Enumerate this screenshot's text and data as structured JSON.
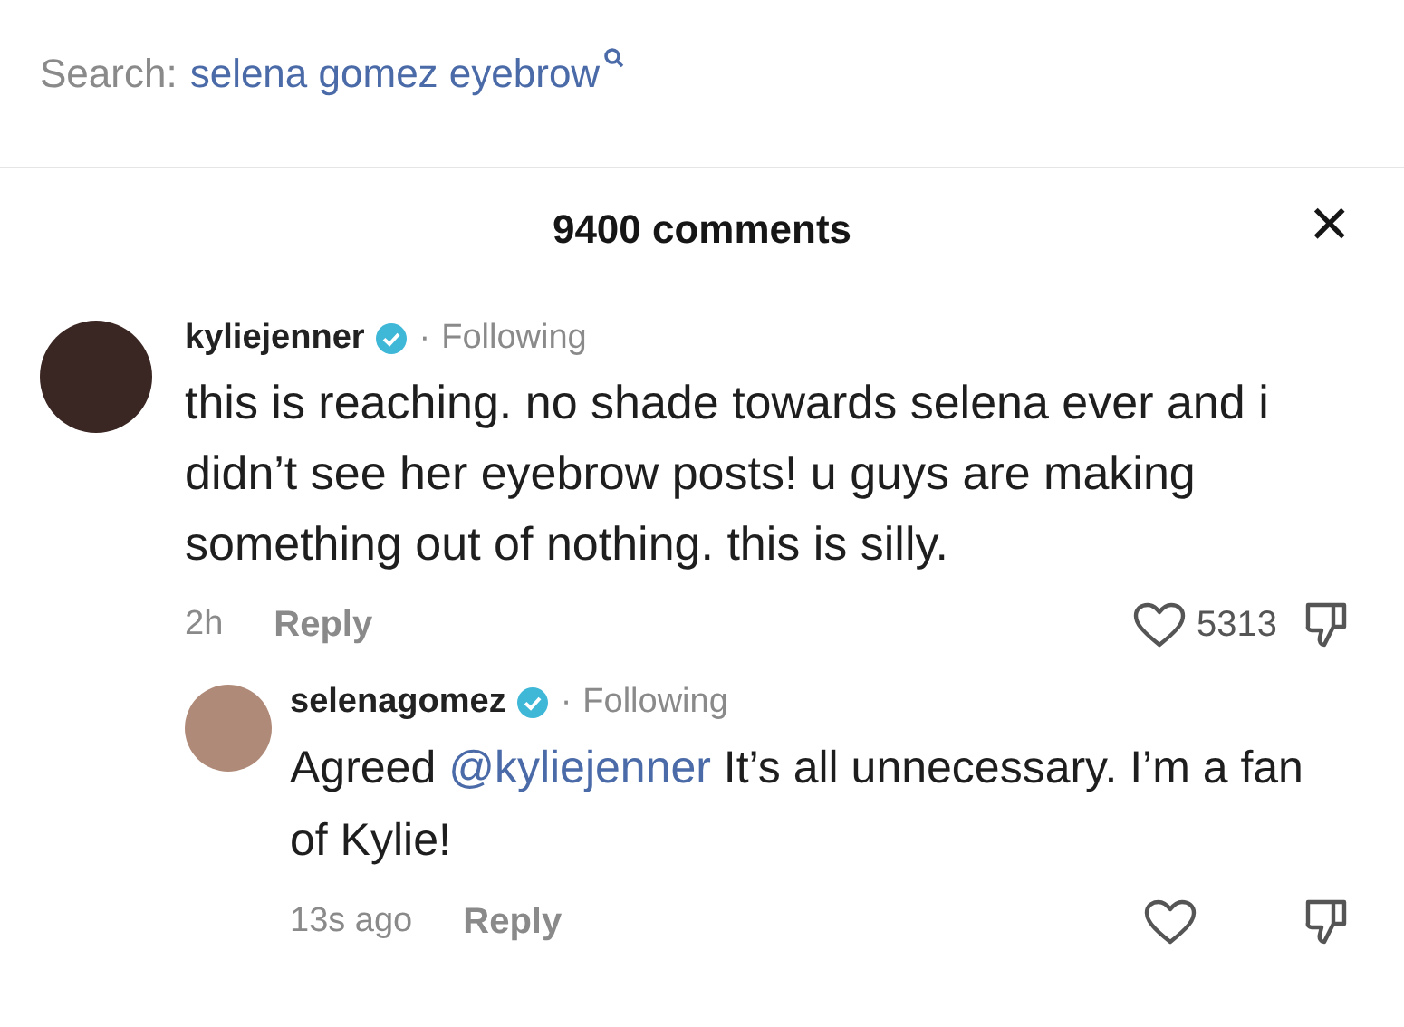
{
  "search": {
    "label": "Search:",
    "query": "selena gomez eyebrow"
  },
  "header": {
    "title": "9400 comments",
    "close": "×"
  },
  "comments": [
    {
      "username": "kyliejenner",
      "verified": true,
      "separator": "·",
      "follow_label": "Following",
      "segments": [
        {
          "kind": "text",
          "text": "this is reaching. no shade towards selena ever and i didn’t see her eyebrow posts! u guys are making something out of nothing. this is silly."
        }
      ],
      "time": "2h",
      "reply_label": "Reply",
      "likes": "5313",
      "children": [
        {
          "username": "selenagomez",
          "verified": true,
          "separator": "·",
          "follow_label": "Following",
          "segments": [
            {
              "kind": "text",
              "text": "Agreed "
            },
            {
              "kind": "mention",
              "text": "@kyliejenner"
            },
            {
              "kind": "text",
              "text": " It’s all unnecessary. I’m a fan of Kylie!"
            }
          ],
          "time": "13s ago",
          "reply_label": "Reply"
        }
      ]
    }
  ]
}
